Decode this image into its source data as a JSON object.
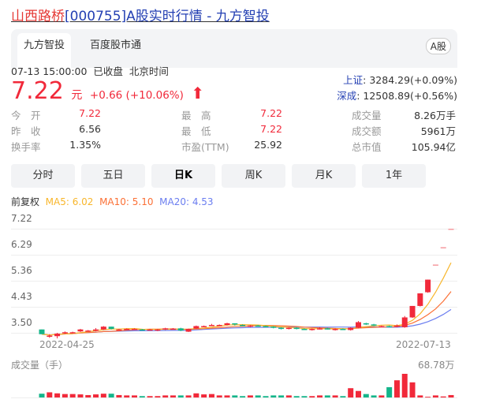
{
  "title": {
    "name": "山西路桥",
    "rest": "[000755]A股实时行情 - 九方智投"
  },
  "tabs": [
    "九方智投",
    "百度股市通"
  ],
  "market_badge": "A股",
  "status": {
    "time": "07-13 15:00:00",
    "state": "已收盘",
    "tz": "北京时间"
  },
  "price": {
    "value": "7.22",
    "unit": "元",
    "change": "+0.66 (+10.06%)"
  },
  "indices": [
    {
      "name": "上证",
      "value": "3284.29(+0.09%)"
    },
    {
      "name": "深成",
      "value": "12508.89(+0.56%)"
    }
  ],
  "stats": [
    {
      "label": "今　开",
      "value": "7.22",
      "red": true
    },
    {
      "label": "最　高",
      "value": "7.22",
      "red": true
    },
    {
      "label": "成交量",
      "value": "8.26万手"
    },
    {
      "label": "昨　收",
      "value": "6.56"
    },
    {
      "label": "最　低",
      "value": "7.22",
      "red": true
    },
    {
      "label": "成交额",
      "value": "5961万"
    },
    {
      "label": "换手率",
      "value": "1.35%"
    },
    {
      "label": "市盈(TTM)",
      "value": "25.92"
    },
    {
      "label": "总市值",
      "value": "105.94亿"
    }
  ],
  "periods": [
    "分时",
    "五日",
    "日K",
    "周K",
    "月K",
    "1年"
  ],
  "active_period": "日K",
  "ma": {
    "adj": "前复权",
    "ma5": "MA5: 6.02",
    "ma10": "MA10: 5.10",
    "ma20": "MA20: 4.53"
  },
  "colors": {
    "up": "#f1293a",
    "down": "#14b58a",
    "ma5": "#f8b62b",
    "ma10": "#fb7036",
    "ma20": "#6b7ef0"
  },
  "chart_data": {
    "type": "candlestick",
    "y_ticks": [
      "7.22",
      "6.29",
      "5.36",
      "4.43",
      "3.50"
    ],
    "ylim": [
      3.5,
      7.22
    ],
    "x_labels": [
      "2022-04-25",
      "2022-07-13"
    ],
    "volume_label": "成交量（手）",
    "volume_max": "68.78万",
    "ohlc": [
      [
        3.62,
        3.62,
        3.45,
        3.45
      ],
      [
        3.4,
        3.45,
        3.32,
        3.4
      ],
      [
        3.38,
        3.5,
        3.3,
        3.47
      ],
      [
        3.5,
        3.55,
        3.45,
        3.52
      ],
      [
        3.5,
        3.54,
        3.48,
        3.52
      ],
      [
        3.55,
        3.64,
        3.53,
        3.62
      ],
      [
        3.58,
        3.6,
        3.55,
        3.58
      ],
      [
        3.57,
        3.67,
        3.55,
        3.62
      ],
      [
        3.62,
        3.74,
        3.6,
        3.72
      ],
      [
        3.72,
        3.72,
        3.62,
        3.64
      ],
      [
        3.6,
        3.64,
        3.58,
        3.62
      ],
      [
        3.62,
        3.66,
        3.6,
        3.64
      ],
      [
        3.64,
        3.66,
        3.62,
        3.64
      ],
      [
        3.62,
        3.64,
        3.58,
        3.6
      ],
      [
        3.62,
        3.64,
        3.6,
        3.62
      ],
      [
        3.6,
        3.64,
        3.56,
        3.62
      ],
      [
        3.62,
        3.68,
        3.6,
        3.66
      ],
      [
        3.64,
        3.67,
        3.62,
        3.65
      ],
      [
        3.66,
        3.68,
        3.56,
        3.58
      ],
      [
        3.54,
        3.65,
        3.53,
        3.64
      ],
      [
        3.65,
        3.76,
        3.64,
        3.74
      ],
      [
        3.72,
        3.76,
        3.7,
        3.74
      ],
      [
        3.76,
        3.82,
        3.74,
        3.78
      ],
      [
        3.78,
        3.8,
        3.76,
        3.78
      ],
      [
        3.78,
        3.86,
        3.76,
        3.84
      ],
      [
        3.84,
        3.84,
        3.76,
        3.8
      ],
      [
        3.78,
        3.8,
        3.74,
        3.76
      ],
      [
        3.74,
        3.78,
        3.7,
        3.76
      ],
      [
        3.76,
        3.78,
        3.72,
        3.74
      ],
      [
        3.74,
        3.76,
        3.7,
        3.72
      ],
      [
        3.72,
        3.74,
        3.66,
        3.68
      ],
      [
        3.68,
        3.7,
        3.62,
        3.64
      ],
      [
        3.64,
        3.7,
        3.62,
        3.68
      ],
      [
        3.68,
        3.7,
        3.62,
        3.64
      ],
      [
        3.64,
        3.66,
        3.6,
        3.62
      ],
      [
        3.62,
        3.66,
        3.58,
        3.64
      ],
      [
        3.64,
        3.7,
        3.62,
        3.66
      ],
      [
        3.66,
        3.68,
        3.62,
        3.64
      ],
      [
        3.62,
        3.66,
        3.58,
        3.64
      ],
      [
        3.64,
        3.66,
        3.6,
        3.62
      ],
      [
        3.6,
        3.7,
        3.58,
        3.68
      ],
      [
        3.68,
        3.92,
        3.66,
        3.88
      ],
      [
        3.84,
        3.86,
        3.78,
        3.8
      ],
      [
        3.8,
        3.82,
        3.74,
        3.76
      ],
      [
        3.72,
        3.76,
        3.7,
        3.74
      ],
      [
        3.74,
        3.76,
        3.7,
        3.72
      ],
      [
        3.72,
        3.8,
        3.7,
        3.76
      ],
      [
        3.7,
        4.1,
        3.68,
        4.05
      ],
      [
        4.05,
        4.46,
        4.03,
        4.46
      ],
      [
        4.46,
        4.91,
        4.44,
        4.91
      ],
      [
        4.95,
        5.4,
        4.93,
        5.4
      ],
      [
        5.94,
        5.94,
        5.94,
        5.94
      ],
      [
        6.56,
        6.56,
        6.56,
        6.56
      ],
      [
        7.22,
        7.22,
        7.22,
        7.22
      ]
    ],
    "volume_wan": [
      11,
      15,
      12,
      10,
      10,
      9,
      7,
      9,
      11,
      11,
      7,
      6,
      6,
      4,
      4,
      4,
      6,
      6,
      6,
      6,
      12,
      9,
      10,
      6,
      6,
      6,
      4,
      6,
      6,
      4,
      6,
      6,
      6,
      4,
      4,
      4,
      6,
      6,
      6,
      4,
      27,
      19,
      10,
      6,
      6,
      30,
      50,
      68.78,
      44,
      6,
      2,
      6,
      3,
      7
    ]
  }
}
